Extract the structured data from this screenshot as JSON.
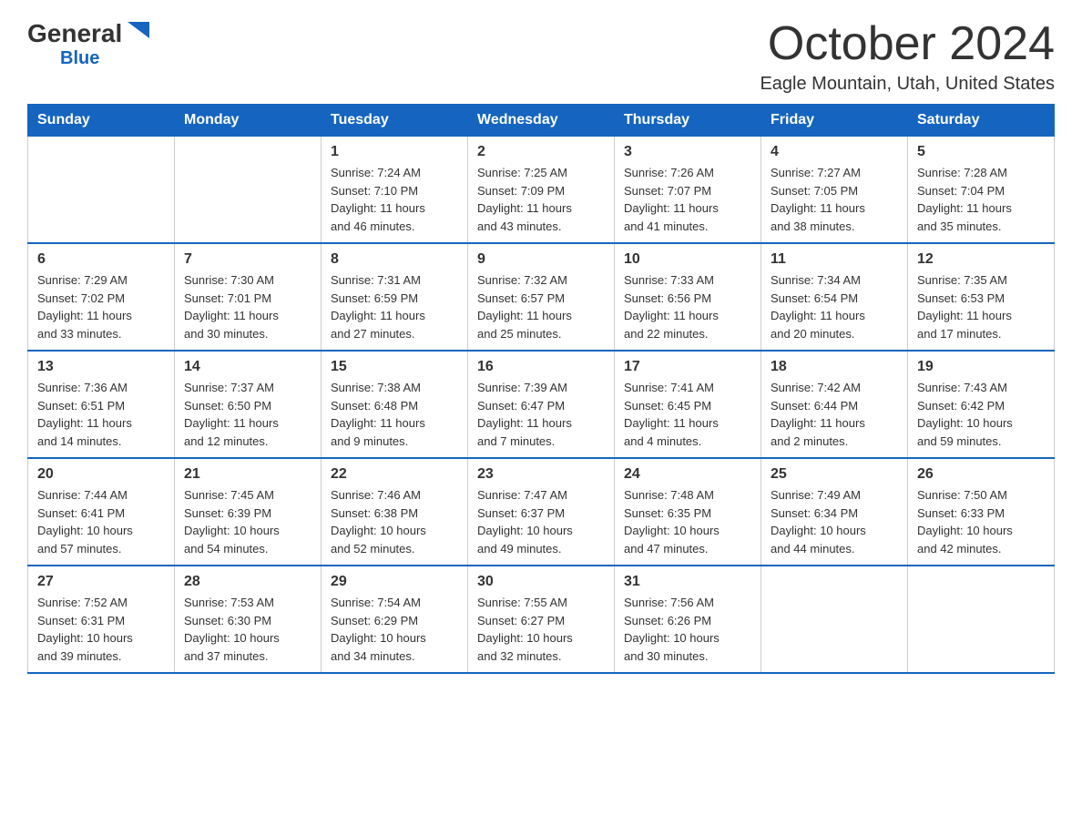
{
  "logo": {
    "general": "General",
    "blue": "Blue",
    "arrow": "▶"
  },
  "title": "October 2024",
  "location": "Eagle Mountain, Utah, United States",
  "days_of_week": [
    "Sunday",
    "Monday",
    "Tuesday",
    "Wednesday",
    "Thursday",
    "Friday",
    "Saturday"
  ],
  "weeks": [
    [
      {
        "day": "",
        "info": ""
      },
      {
        "day": "",
        "info": ""
      },
      {
        "day": "1",
        "info": "Sunrise: 7:24 AM\nSunset: 7:10 PM\nDaylight: 11 hours\nand 46 minutes."
      },
      {
        "day": "2",
        "info": "Sunrise: 7:25 AM\nSunset: 7:09 PM\nDaylight: 11 hours\nand 43 minutes."
      },
      {
        "day": "3",
        "info": "Sunrise: 7:26 AM\nSunset: 7:07 PM\nDaylight: 11 hours\nand 41 minutes."
      },
      {
        "day": "4",
        "info": "Sunrise: 7:27 AM\nSunset: 7:05 PM\nDaylight: 11 hours\nand 38 minutes."
      },
      {
        "day": "5",
        "info": "Sunrise: 7:28 AM\nSunset: 7:04 PM\nDaylight: 11 hours\nand 35 minutes."
      }
    ],
    [
      {
        "day": "6",
        "info": "Sunrise: 7:29 AM\nSunset: 7:02 PM\nDaylight: 11 hours\nand 33 minutes."
      },
      {
        "day": "7",
        "info": "Sunrise: 7:30 AM\nSunset: 7:01 PM\nDaylight: 11 hours\nand 30 minutes."
      },
      {
        "day": "8",
        "info": "Sunrise: 7:31 AM\nSunset: 6:59 PM\nDaylight: 11 hours\nand 27 minutes."
      },
      {
        "day": "9",
        "info": "Sunrise: 7:32 AM\nSunset: 6:57 PM\nDaylight: 11 hours\nand 25 minutes."
      },
      {
        "day": "10",
        "info": "Sunrise: 7:33 AM\nSunset: 6:56 PM\nDaylight: 11 hours\nand 22 minutes."
      },
      {
        "day": "11",
        "info": "Sunrise: 7:34 AM\nSunset: 6:54 PM\nDaylight: 11 hours\nand 20 minutes."
      },
      {
        "day": "12",
        "info": "Sunrise: 7:35 AM\nSunset: 6:53 PM\nDaylight: 11 hours\nand 17 minutes."
      }
    ],
    [
      {
        "day": "13",
        "info": "Sunrise: 7:36 AM\nSunset: 6:51 PM\nDaylight: 11 hours\nand 14 minutes."
      },
      {
        "day": "14",
        "info": "Sunrise: 7:37 AM\nSunset: 6:50 PM\nDaylight: 11 hours\nand 12 minutes."
      },
      {
        "day": "15",
        "info": "Sunrise: 7:38 AM\nSunset: 6:48 PM\nDaylight: 11 hours\nand 9 minutes."
      },
      {
        "day": "16",
        "info": "Sunrise: 7:39 AM\nSunset: 6:47 PM\nDaylight: 11 hours\nand 7 minutes."
      },
      {
        "day": "17",
        "info": "Sunrise: 7:41 AM\nSunset: 6:45 PM\nDaylight: 11 hours\nand 4 minutes."
      },
      {
        "day": "18",
        "info": "Sunrise: 7:42 AM\nSunset: 6:44 PM\nDaylight: 11 hours\nand 2 minutes."
      },
      {
        "day": "19",
        "info": "Sunrise: 7:43 AM\nSunset: 6:42 PM\nDaylight: 10 hours\nand 59 minutes."
      }
    ],
    [
      {
        "day": "20",
        "info": "Sunrise: 7:44 AM\nSunset: 6:41 PM\nDaylight: 10 hours\nand 57 minutes."
      },
      {
        "day": "21",
        "info": "Sunrise: 7:45 AM\nSunset: 6:39 PM\nDaylight: 10 hours\nand 54 minutes."
      },
      {
        "day": "22",
        "info": "Sunrise: 7:46 AM\nSunset: 6:38 PM\nDaylight: 10 hours\nand 52 minutes."
      },
      {
        "day": "23",
        "info": "Sunrise: 7:47 AM\nSunset: 6:37 PM\nDaylight: 10 hours\nand 49 minutes."
      },
      {
        "day": "24",
        "info": "Sunrise: 7:48 AM\nSunset: 6:35 PM\nDaylight: 10 hours\nand 47 minutes."
      },
      {
        "day": "25",
        "info": "Sunrise: 7:49 AM\nSunset: 6:34 PM\nDaylight: 10 hours\nand 44 minutes."
      },
      {
        "day": "26",
        "info": "Sunrise: 7:50 AM\nSunset: 6:33 PM\nDaylight: 10 hours\nand 42 minutes."
      }
    ],
    [
      {
        "day": "27",
        "info": "Sunrise: 7:52 AM\nSunset: 6:31 PM\nDaylight: 10 hours\nand 39 minutes."
      },
      {
        "day": "28",
        "info": "Sunrise: 7:53 AM\nSunset: 6:30 PM\nDaylight: 10 hours\nand 37 minutes."
      },
      {
        "day": "29",
        "info": "Sunrise: 7:54 AM\nSunset: 6:29 PM\nDaylight: 10 hours\nand 34 minutes."
      },
      {
        "day": "30",
        "info": "Sunrise: 7:55 AM\nSunset: 6:27 PM\nDaylight: 10 hours\nand 32 minutes."
      },
      {
        "day": "31",
        "info": "Sunrise: 7:56 AM\nSunset: 6:26 PM\nDaylight: 10 hours\nand 30 minutes."
      },
      {
        "day": "",
        "info": ""
      },
      {
        "day": "",
        "info": ""
      }
    ]
  ]
}
